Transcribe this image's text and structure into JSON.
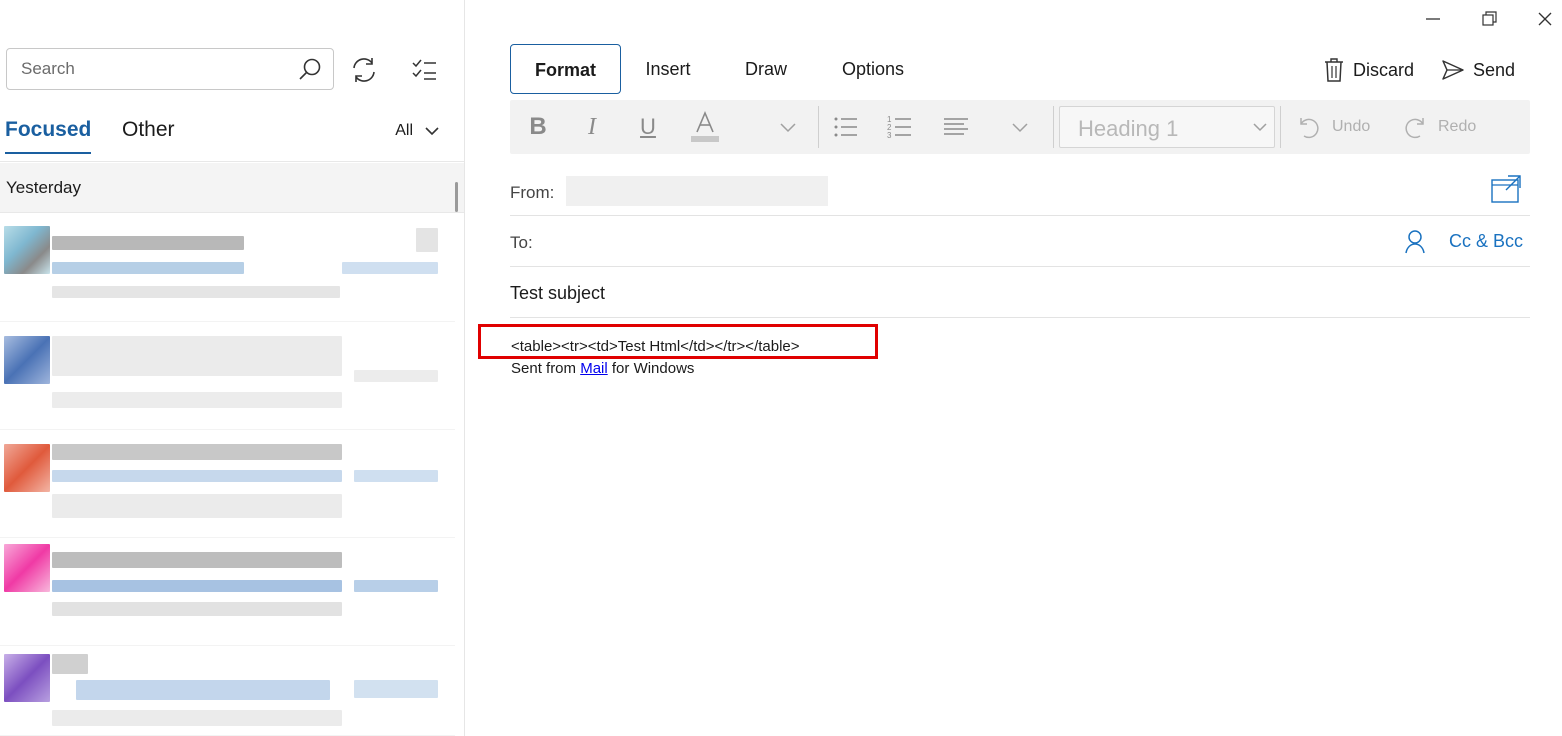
{
  "left_pane": {
    "search": {
      "placeholder": "Search"
    },
    "tabs": [
      {
        "label": "Focused",
        "active": true
      },
      {
        "label": "Other",
        "active": false
      }
    ],
    "filter": {
      "label": "All"
    },
    "section_header": "Yesterday",
    "message_avatar_colors": [
      "#7fb7d0",
      "#4a72b5",
      "#e05a3c",
      "#f03aa5",
      "#7c4fc0"
    ]
  },
  "compose": {
    "format_tabs": [
      {
        "label": "Format",
        "active": true
      },
      {
        "label": "Insert",
        "active": false
      },
      {
        "label": "Draw",
        "active": false
      },
      {
        "label": "Options",
        "active": false
      }
    ],
    "actions": {
      "discard": "Discard",
      "send": "Send"
    },
    "ribbon": {
      "style": "Heading 1",
      "undo": "Undo",
      "redo": "Redo"
    },
    "from_label": "From:",
    "to_label": "To:",
    "cc_bcc": "Cc & Bcc",
    "subject": "Test subject",
    "body_line1": "<table><tr><td>Test Html</td></tr></table>",
    "body_sent_prefix": "Sent from",
    "body_link": "Mail",
    "body_sent_suffix": "for Windows"
  },
  "colors": {
    "accent": "#1a5fa0",
    "link": "#0078d4",
    "highlight": "#e00000"
  }
}
